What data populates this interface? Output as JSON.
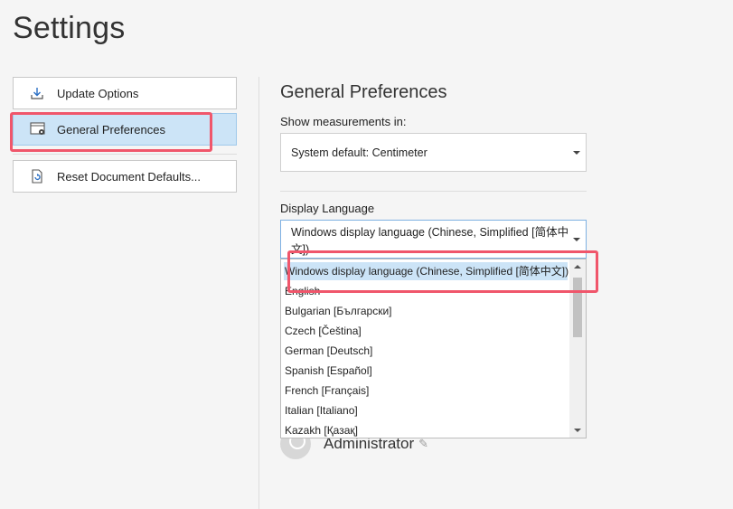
{
  "page": {
    "title": "Settings"
  },
  "nav": {
    "items": [
      {
        "label": "Update Options",
        "icon": "download-icon"
      },
      {
        "label": "General Preferences",
        "icon": "window-gear-icon"
      },
      {
        "label": "Reset Document Defaults...",
        "icon": "document-reset-icon"
      }
    ],
    "selected_index": 1
  },
  "main": {
    "section_title": "General Preferences",
    "measurements": {
      "label": "Show measurements in:",
      "value": "System default: Centimeter"
    },
    "language": {
      "label": "Display Language",
      "value": "Windows display language (Chinese, Simplified [简体中文])",
      "options": [
        "Windows display language (Chinese, Simplified [简体中文])",
        "English",
        "Bulgarian [Български]",
        "Czech [Čeština]",
        "German [Deutsch]",
        "Spanish [Español]",
        "French [Français]",
        "Italian [Italiano]",
        "Kazakh [Қазақ]"
      ],
      "selected_option_index": 0
    },
    "user": {
      "name": "Administrator",
      "edit_icon": "pencil-icon"
    }
  },
  "colors": {
    "accent_selected": "#cce4f7",
    "highlight": "#f0566b"
  }
}
